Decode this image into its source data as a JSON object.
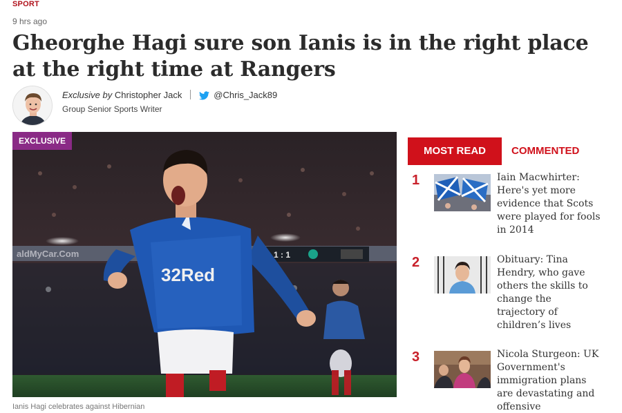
{
  "article": {
    "section": "SPORT",
    "time_ago": "9 hrs ago",
    "headline": "Gheorghe Hagi sure son Ianis is in the right place at the right time at Rangers",
    "byline": {
      "prefix": "Exclusive by",
      "author": "Christopher Jack",
      "twitter": "@Chris_Jack89",
      "role": "Group Senior Sports Writer"
    },
    "hero": {
      "badge": "EXCLUSIVE",
      "caption": "Ianis Hagi celebrates against Hibernian",
      "shirt_sponsor": "32Red",
      "scoreboard": "1 : 1"
    }
  },
  "sidebar": {
    "tabs": [
      {
        "label": "MOST READ",
        "active": true
      },
      {
        "label": "COMMENTED",
        "active": false
      }
    ],
    "items": [
      {
        "rank": "1",
        "title": "Iain Macwhirter: Here's yet more evidence that Scots were played for fools in 2014"
      },
      {
        "rank": "2",
        "title": "Obituary: Tina Hendry, who gave others the skills to change the trajectory of children’s lives"
      },
      {
        "rank": "3",
        "title": "Nicola Sturgeon: UK Government's immigration plans are devastating and offensive"
      }
    ]
  },
  "colors": {
    "accent_red": "#d0111b",
    "badge_purple": "#8a2a86",
    "twitter_blue": "#1da1f2"
  }
}
